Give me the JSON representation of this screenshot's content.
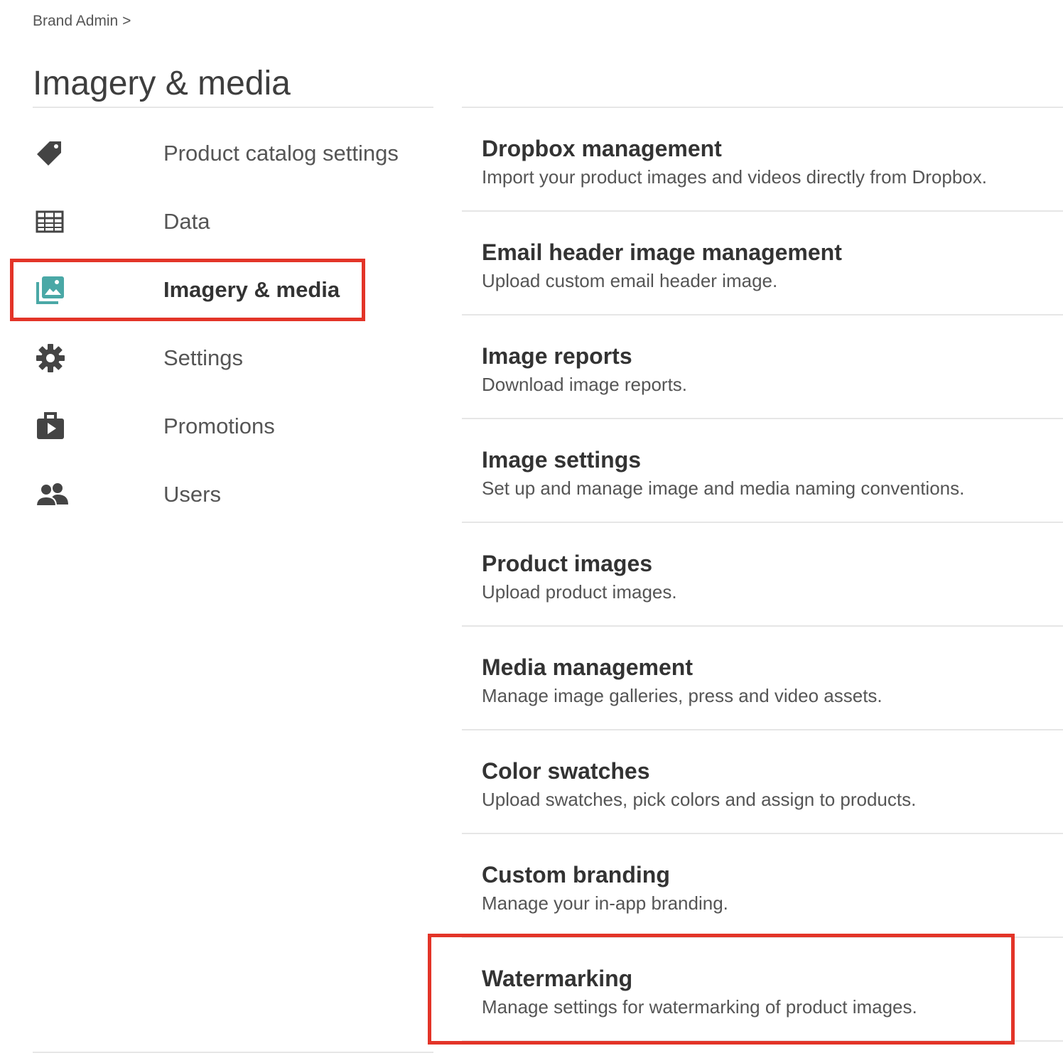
{
  "breadcrumb": "Brand Admin >",
  "page_title": "Imagery & media",
  "nav": {
    "items": [
      {
        "label": "Product catalog settings",
        "icon": "tag-icon",
        "active": false
      },
      {
        "label": "Data",
        "icon": "table-grid-icon",
        "active": false
      },
      {
        "label": "Imagery & media",
        "icon": "images-icon",
        "active": true
      },
      {
        "label": "Settings",
        "icon": "gear-icon",
        "active": false
      },
      {
        "label": "Promotions",
        "icon": "briefcase-play-icon",
        "active": false
      },
      {
        "label": "Users",
        "icon": "users-icon",
        "active": false
      }
    ]
  },
  "settings": {
    "items": [
      {
        "title": "Dropbox management",
        "description": "Import your product images and videos directly from Dropbox."
      },
      {
        "title": "Email header image management",
        "description": "Upload custom email header image."
      },
      {
        "title": "Image reports",
        "description": "Download image reports."
      },
      {
        "title": "Image settings",
        "description": "Set up and manage image and media naming conventions."
      },
      {
        "title": "Product images",
        "description": "Upload product images."
      },
      {
        "title": "Media management",
        "description": "Manage image galleries, press and video assets."
      },
      {
        "title": "Color swatches",
        "description": "Upload swatches, pick colors and assign to products."
      },
      {
        "title": "Custom branding",
        "description": "Manage your in-app branding."
      },
      {
        "title": "Watermarking",
        "description": "Manage settings for watermarking of product images."
      }
    ]
  },
  "colors": {
    "highlight": "#e33428",
    "active_icon": "#4aa8a6",
    "text_dark": "#333333",
    "text_muted": "#555555",
    "divider": "#e6e6e6"
  }
}
